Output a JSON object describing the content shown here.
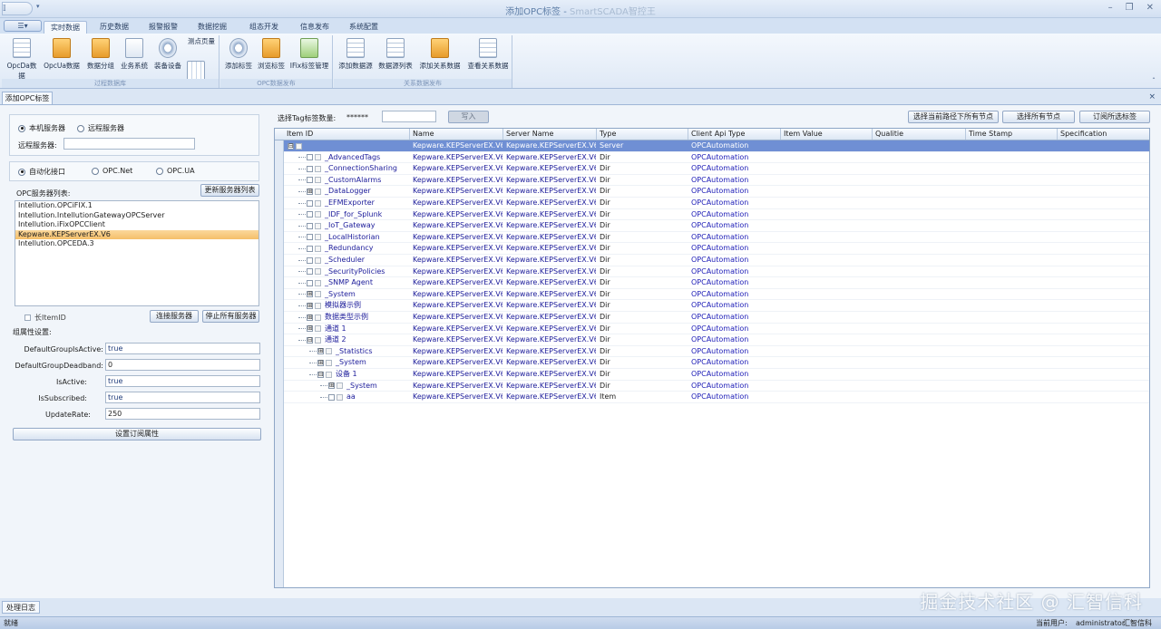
{
  "window": {
    "title": "添加OPC标签",
    "subtitle": "SmartSCADA智控王",
    "qat_logo": "𝕀",
    "qat_drop": "▾",
    "minimize": "–",
    "restore": "❐",
    "close": "✕"
  },
  "menu": {
    "app_button": "☰▾",
    "tabs": [
      "实时数据",
      "历史数据",
      "报警报警",
      "数据挖掘",
      "组态开发",
      "信息发布",
      "系统配置"
    ]
  },
  "ribbon": {
    "groups": [
      {
        "label": "过程数据库",
        "buttons": [
          "OpcDa数据",
          "OpcUa数据",
          "数据分组",
          "业务系统",
          "装备设备",
          "测点页量"
        ]
      },
      {
        "label": "OPC数据发布",
        "buttons": [
          "添加标签",
          "浏览标签",
          "IFix标签管理"
        ]
      },
      {
        "label": "关系数据发布",
        "buttons": [
          "添加数据源",
          "数据源列表",
          "添加关系数据",
          "查看关系数据"
        ]
      }
    ],
    "collapse": "ˆ"
  },
  "doc_tab": "添加OPC标签",
  "doc_close": "×",
  "left_panel": {
    "server_type": {
      "local": "本机服务器",
      "remote": "远程服务器",
      "selected": "local"
    },
    "remote_server_label": "远程服务器:",
    "remote_server_value": "",
    "interface": {
      "auto": "自动化接口",
      "net": "OPC.Net",
      "ua": "OPC.UA",
      "selected": "auto"
    },
    "server_list_label": "OPC服务器列表:",
    "refresh_button": "更新服务器列表",
    "servers": [
      "Intellution.OPCiFIX.1",
      "Intellution.IntellutionGatewayOPCServer",
      "Intellution.iFixOPCClient",
      "Kepware.KEPServerEX.V6",
      "Intellution.OPCEDA.3"
    ],
    "selected_server": "Kepware.KEPServerEX.V6",
    "long_item_id": "长ItemID",
    "connect_button": "连接服务器",
    "stop_button": "停止所有服务器",
    "group_settings_label": "组属性设置:",
    "props": [
      {
        "label": "DefaultGroupIsActive:",
        "value": "true"
      },
      {
        "label": "DefaultGroupDeadband:",
        "value": "0"
      },
      {
        "label": "IsActive:",
        "value": "true"
      },
      {
        "label": "IsSubscribed:",
        "value": "true"
      },
      {
        "label": "UpdateRate:",
        "value": "250"
      }
    ],
    "set_button": "设置订阅属性"
  },
  "right_panel": {
    "tag_count_label": "选择Tag标签数量:",
    "tag_count_value": "******",
    "import_input": "",
    "import_button": "写入",
    "btn_select_path": "选择当前路径下所有节点",
    "btn_select_all": "选择所有节点",
    "btn_subscribe": "订阅所选标签"
  },
  "grid": {
    "columns": [
      "Item ID",
      "Name",
      "Server Name",
      "Type",
      "Client Api Type",
      "Item Value",
      "Qualitie",
      "Time Stamp",
      "Specification"
    ],
    "rows": [
      {
        "id": "",
        "name": "Kepware.KEPServerEX.V6",
        "server": "Kepware.KEPServerEX.V6",
        "type": "Server",
        "api": "OPCAutomation",
        "value": "",
        "depth": 0,
        "exp": "⊟",
        "sel": true
      },
      {
        "id": "_AdvancedTags",
        "name": "Kepware.KEPServerEX.V6",
        "server": "Kepware.KEPServerEX.V6",
        "type": "Dir",
        "api": "OPCAutomation",
        "depth": 1,
        "exp": ""
      },
      {
        "id": "_ConnectionSharing",
        "name": "Kepware.KEPServerEX.V6",
        "server": "Kepware.KEPServerEX.V6",
        "type": "Dir",
        "api": "OPCAutomation",
        "depth": 1,
        "exp": ""
      },
      {
        "id": "_CustomAlarms",
        "name": "Kepware.KEPServerEX.V6",
        "server": "Kepware.KEPServerEX.V6",
        "type": "Dir",
        "api": "OPCAutomation",
        "depth": 1,
        "exp": ""
      },
      {
        "id": "_DataLogger",
        "name": "Kepware.KEPServerEX.V6",
        "server": "Kepware.KEPServerEX.V6",
        "type": "Dir",
        "api": "OPCAutomation",
        "depth": 1,
        "exp": "⊞"
      },
      {
        "id": "_EFMExporter",
        "name": "Kepware.KEPServerEX.V6",
        "server": "Kepware.KEPServerEX.V6",
        "type": "Dir",
        "api": "OPCAutomation",
        "depth": 1,
        "exp": ""
      },
      {
        "id": "_IDF_for_Splunk",
        "name": "Kepware.KEPServerEX.V6",
        "server": "Kepware.KEPServerEX.V6",
        "type": "Dir",
        "api": "OPCAutomation",
        "depth": 1,
        "exp": ""
      },
      {
        "id": "_IoT_Gateway",
        "name": "Kepware.KEPServerEX.V6",
        "server": "Kepware.KEPServerEX.V6",
        "type": "Dir",
        "api": "OPCAutomation",
        "depth": 1,
        "exp": ""
      },
      {
        "id": "_LocalHistorian",
        "name": "Kepware.KEPServerEX.V6",
        "server": "Kepware.KEPServerEX.V6",
        "type": "Dir",
        "api": "OPCAutomation",
        "depth": 1,
        "exp": ""
      },
      {
        "id": "_Redundancy",
        "name": "Kepware.KEPServerEX.V6",
        "server": "Kepware.KEPServerEX.V6",
        "type": "Dir",
        "api": "OPCAutomation",
        "depth": 1,
        "exp": ""
      },
      {
        "id": "_Scheduler",
        "name": "Kepware.KEPServerEX.V6",
        "server": "Kepware.KEPServerEX.V6",
        "type": "Dir",
        "api": "OPCAutomation",
        "depth": 1,
        "exp": ""
      },
      {
        "id": "_SecurityPolicies",
        "name": "Kepware.KEPServerEX.V6",
        "server": "Kepware.KEPServerEX.V6",
        "type": "Dir",
        "api": "OPCAutomation",
        "depth": 1,
        "exp": ""
      },
      {
        "id": "_SNMP Agent",
        "name": "Kepware.KEPServerEX.V6",
        "server": "Kepware.KEPServerEX.V6",
        "type": "Dir",
        "api": "OPCAutomation",
        "depth": 1,
        "exp": ""
      },
      {
        "id": "_System",
        "name": "Kepware.KEPServerEX.V6",
        "server": "Kepware.KEPServerEX.V6",
        "type": "Dir",
        "api": "OPCAutomation",
        "depth": 1,
        "exp": "⊞"
      },
      {
        "id": "模拟器示例",
        "name": "Kepware.KEPServerEX.V6",
        "server": "Kepware.KEPServerEX.V6",
        "type": "Dir",
        "api": "OPCAutomation",
        "depth": 1,
        "exp": "⊞"
      },
      {
        "id": "数据类型示例",
        "name": "Kepware.KEPServerEX.V6",
        "server": "Kepware.KEPServerEX.V6",
        "type": "Dir",
        "api": "OPCAutomation",
        "depth": 1,
        "exp": "⊞"
      },
      {
        "id": "通道 1",
        "name": "Kepware.KEPServerEX.V6",
        "server": "Kepware.KEPServerEX.V6",
        "type": "Dir",
        "api": "OPCAutomation",
        "depth": 1,
        "exp": "⊞"
      },
      {
        "id": "通道 2",
        "name": "Kepware.KEPServerEX.V6",
        "server": "Kepware.KEPServerEX.V6",
        "type": "Dir",
        "api": "OPCAutomation",
        "depth": 1,
        "exp": "⊟"
      },
      {
        "id": "_Statistics",
        "name": "Kepware.KEPServerEX.V6",
        "server": "Kepware.KEPServerEX.V6",
        "type": "Dir",
        "api": "OPCAutomation",
        "depth": 2,
        "exp": "⊞"
      },
      {
        "id": "_System",
        "name": "Kepware.KEPServerEX.V6",
        "server": "Kepware.KEPServerEX.V6",
        "type": "Dir",
        "api": "OPCAutomation",
        "depth": 2,
        "exp": "⊞"
      },
      {
        "id": "设备 1",
        "name": "Kepware.KEPServerEX.V6",
        "server": "Kepware.KEPServerEX.V6",
        "type": "Dir",
        "api": "OPCAutomation",
        "depth": 2,
        "exp": "⊟"
      },
      {
        "id": "_System",
        "name": "Kepware.KEPServerEX.V6",
        "server": "Kepware.KEPServerEX.V6",
        "type": "Dir",
        "api": "OPCAutomation",
        "depth": 3,
        "exp": "⊞"
      },
      {
        "id": "aa",
        "name": "Kepware.KEPServerEX.V6",
        "server": "Kepware.KEPServerEX.V6",
        "type": "Item",
        "api": "OPCAutomation",
        "depth": 3,
        "exp": ""
      }
    ]
  },
  "bottom_tab": "处理日志",
  "status": {
    "left": "就绪",
    "user_label": "当前用户:",
    "user": "administrator",
    "company": "汇智信科"
  },
  "watermark": "掘金技术社区 @ 汇智信科"
}
